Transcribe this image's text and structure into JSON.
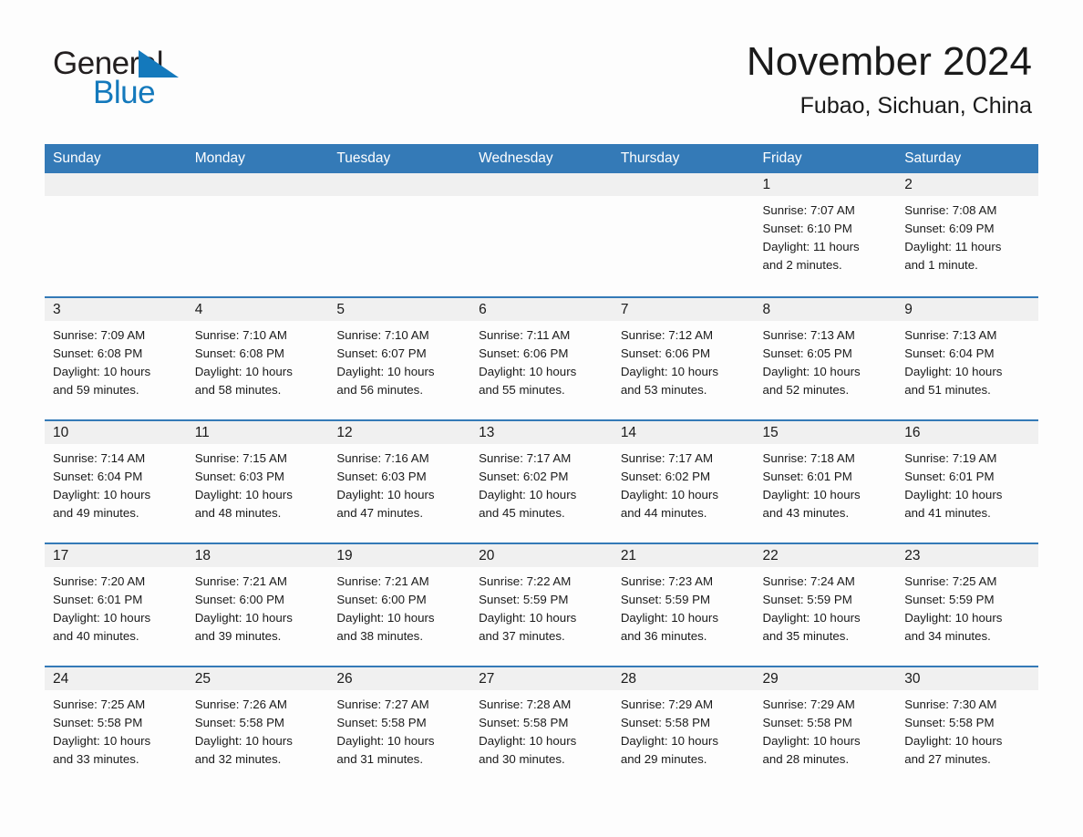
{
  "logo": {
    "word1": "General",
    "word2": "Blue",
    "triangle_color": "#1479bc"
  },
  "header": {
    "month_title": "November 2024",
    "location": "Fubao, Sichuan, China"
  },
  "theme": {
    "header_blue": "#347ab7",
    "daynum_band": "#f0f0f0",
    "page_bg": "#fdfdfd",
    "text": "#1a1a1a"
  },
  "weekday_headers": [
    "Sunday",
    "Monday",
    "Tuesday",
    "Wednesday",
    "Thursday",
    "Friday",
    "Saturday"
  ],
  "labels": {
    "sunrise_prefix": "Sunrise:",
    "sunset_prefix": "Sunset:",
    "daylight_prefix": "Daylight:"
  },
  "weeks": [
    [
      {
        "day": "",
        "sunrise": "",
        "sunset": "",
        "daylight_line1": "",
        "daylight_line2": ""
      },
      {
        "day": "",
        "sunrise": "",
        "sunset": "",
        "daylight_line1": "",
        "daylight_line2": ""
      },
      {
        "day": "",
        "sunrise": "",
        "sunset": "",
        "daylight_line1": "",
        "daylight_line2": ""
      },
      {
        "day": "",
        "sunrise": "",
        "sunset": "",
        "daylight_line1": "",
        "daylight_line2": ""
      },
      {
        "day": "",
        "sunrise": "",
        "sunset": "",
        "daylight_line1": "",
        "daylight_line2": ""
      },
      {
        "day": "1",
        "sunrise": "Sunrise: 7:07 AM",
        "sunset": "Sunset: 6:10 PM",
        "daylight_line1": "Daylight: 11 hours",
        "daylight_line2": "and 2 minutes."
      },
      {
        "day": "2",
        "sunrise": "Sunrise: 7:08 AM",
        "sunset": "Sunset: 6:09 PM",
        "daylight_line1": "Daylight: 11 hours",
        "daylight_line2": "and 1 minute."
      }
    ],
    [
      {
        "day": "3",
        "sunrise": "Sunrise: 7:09 AM",
        "sunset": "Sunset: 6:08 PM",
        "daylight_line1": "Daylight: 10 hours",
        "daylight_line2": "and 59 minutes."
      },
      {
        "day": "4",
        "sunrise": "Sunrise: 7:10 AM",
        "sunset": "Sunset: 6:08 PM",
        "daylight_line1": "Daylight: 10 hours",
        "daylight_line2": "and 58 minutes."
      },
      {
        "day": "5",
        "sunrise": "Sunrise: 7:10 AM",
        "sunset": "Sunset: 6:07 PM",
        "daylight_line1": "Daylight: 10 hours",
        "daylight_line2": "and 56 minutes."
      },
      {
        "day": "6",
        "sunrise": "Sunrise: 7:11 AM",
        "sunset": "Sunset: 6:06 PM",
        "daylight_line1": "Daylight: 10 hours",
        "daylight_line2": "and 55 minutes."
      },
      {
        "day": "7",
        "sunrise": "Sunrise: 7:12 AM",
        "sunset": "Sunset: 6:06 PM",
        "daylight_line1": "Daylight: 10 hours",
        "daylight_line2": "and 53 minutes."
      },
      {
        "day": "8",
        "sunrise": "Sunrise: 7:13 AM",
        "sunset": "Sunset: 6:05 PM",
        "daylight_line1": "Daylight: 10 hours",
        "daylight_line2": "and 52 minutes."
      },
      {
        "day": "9",
        "sunrise": "Sunrise: 7:13 AM",
        "sunset": "Sunset: 6:04 PM",
        "daylight_line1": "Daylight: 10 hours",
        "daylight_line2": "and 51 minutes."
      }
    ],
    [
      {
        "day": "10",
        "sunrise": "Sunrise: 7:14 AM",
        "sunset": "Sunset: 6:04 PM",
        "daylight_line1": "Daylight: 10 hours",
        "daylight_line2": "and 49 minutes."
      },
      {
        "day": "11",
        "sunrise": "Sunrise: 7:15 AM",
        "sunset": "Sunset: 6:03 PM",
        "daylight_line1": "Daylight: 10 hours",
        "daylight_line2": "and 48 minutes."
      },
      {
        "day": "12",
        "sunrise": "Sunrise: 7:16 AM",
        "sunset": "Sunset: 6:03 PM",
        "daylight_line1": "Daylight: 10 hours",
        "daylight_line2": "and 47 minutes."
      },
      {
        "day": "13",
        "sunrise": "Sunrise: 7:17 AM",
        "sunset": "Sunset: 6:02 PM",
        "daylight_line1": "Daylight: 10 hours",
        "daylight_line2": "and 45 minutes."
      },
      {
        "day": "14",
        "sunrise": "Sunrise: 7:17 AM",
        "sunset": "Sunset: 6:02 PM",
        "daylight_line1": "Daylight: 10 hours",
        "daylight_line2": "and 44 minutes."
      },
      {
        "day": "15",
        "sunrise": "Sunrise: 7:18 AM",
        "sunset": "Sunset: 6:01 PM",
        "daylight_line1": "Daylight: 10 hours",
        "daylight_line2": "and 43 minutes."
      },
      {
        "day": "16",
        "sunrise": "Sunrise: 7:19 AM",
        "sunset": "Sunset: 6:01 PM",
        "daylight_line1": "Daylight: 10 hours",
        "daylight_line2": "and 41 minutes."
      }
    ],
    [
      {
        "day": "17",
        "sunrise": "Sunrise: 7:20 AM",
        "sunset": "Sunset: 6:01 PM",
        "daylight_line1": "Daylight: 10 hours",
        "daylight_line2": "and 40 minutes."
      },
      {
        "day": "18",
        "sunrise": "Sunrise: 7:21 AM",
        "sunset": "Sunset: 6:00 PM",
        "daylight_line1": "Daylight: 10 hours",
        "daylight_line2": "and 39 minutes."
      },
      {
        "day": "19",
        "sunrise": "Sunrise: 7:21 AM",
        "sunset": "Sunset: 6:00 PM",
        "daylight_line1": "Daylight: 10 hours",
        "daylight_line2": "and 38 minutes."
      },
      {
        "day": "20",
        "sunrise": "Sunrise: 7:22 AM",
        "sunset": "Sunset: 5:59 PM",
        "daylight_line1": "Daylight: 10 hours",
        "daylight_line2": "and 37 minutes."
      },
      {
        "day": "21",
        "sunrise": "Sunrise: 7:23 AM",
        "sunset": "Sunset: 5:59 PM",
        "daylight_line1": "Daylight: 10 hours",
        "daylight_line2": "and 36 minutes."
      },
      {
        "day": "22",
        "sunrise": "Sunrise: 7:24 AM",
        "sunset": "Sunset: 5:59 PM",
        "daylight_line1": "Daylight: 10 hours",
        "daylight_line2": "and 35 minutes."
      },
      {
        "day": "23",
        "sunrise": "Sunrise: 7:25 AM",
        "sunset": "Sunset: 5:59 PM",
        "daylight_line1": "Daylight: 10 hours",
        "daylight_line2": "and 34 minutes."
      }
    ],
    [
      {
        "day": "24",
        "sunrise": "Sunrise: 7:25 AM",
        "sunset": "Sunset: 5:58 PM",
        "daylight_line1": "Daylight: 10 hours",
        "daylight_line2": "and 33 minutes."
      },
      {
        "day": "25",
        "sunrise": "Sunrise: 7:26 AM",
        "sunset": "Sunset: 5:58 PM",
        "daylight_line1": "Daylight: 10 hours",
        "daylight_line2": "and 32 minutes."
      },
      {
        "day": "26",
        "sunrise": "Sunrise: 7:27 AM",
        "sunset": "Sunset: 5:58 PM",
        "daylight_line1": "Daylight: 10 hours",
        "daylight_line2": "and 31 minutes."
      },
      {
        "day": "27",
        "sunrise": "Sunrise: 7:28 AM",
        "sunset": "Sunset: 5:58 PM",
        "daylight_line1": "Daylight: 10 hours",
        "daylight_line2": "and 30 minutes."
      },
      {
        "day": "28",
        "sunrise": "Sunrise: 7:29 AM",
        "sunset": "Sunset: 5:58 PM",
        "daylight_line1": "Daylight: 10 hours",
        "daylight_line2": "and 29 minutes."
      },
      {
        "day": "29",
        "sunrise": "Sunrise: 7:29 AM",
        "sunset": "Sunset: 5:58 PM",
        "daylight_line1": "Daylight: 10 hours",
        "daylight_line2": "and 28 minutes."
      },
      {
        "day": "30",
        "sunrise": "Sunrise: 7:30 AM",
        "sunset": "Sunset: 5:58 PM",
        "daylight_line1": "Daylight: 10 hours",
        "daylight_line2": "and 27 minutes."
      }
    ]
  ]
}
